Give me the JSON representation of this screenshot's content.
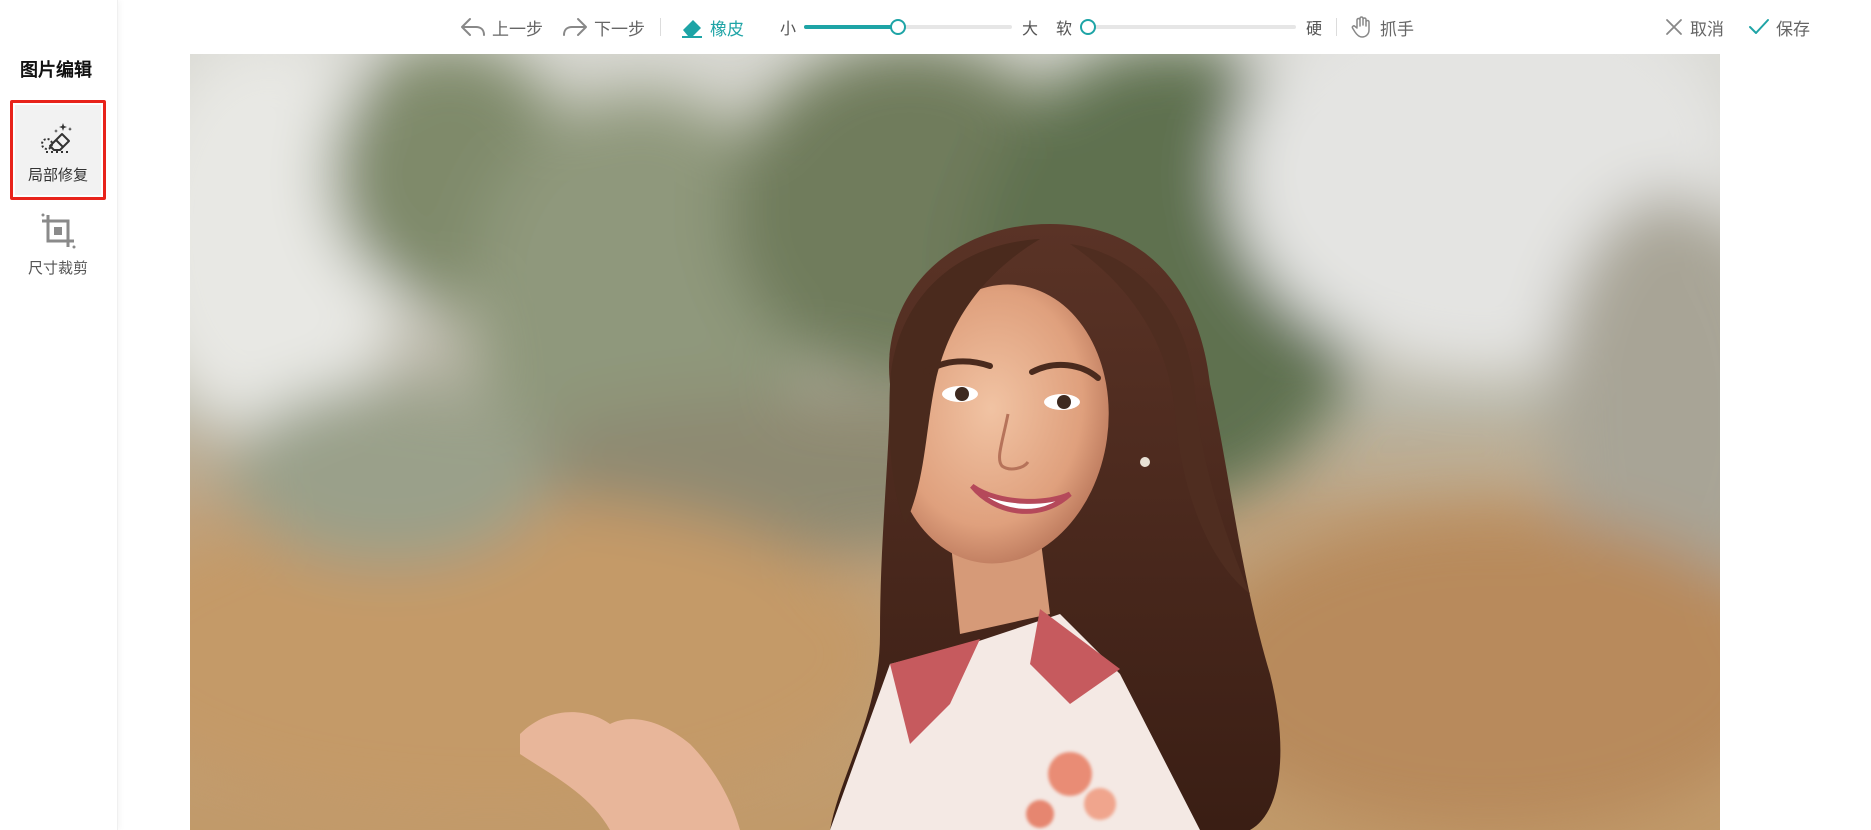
{
  "sidebar": {
    "title": "图片编辑",
    "tools": [
      {
        "label": "局部修复",
        "icon": "eraser-sparkle-icon",
        "active": true
      },
      {
        "label": "尺寸裁剪",
        "icon": "crop-icon",
        "active": false
      }
    ]
  },
  "toolbar": {
    "undo_label": "上一步",
    "redo_label": "下一步",
    "eraser_label": "橡皮",
    "size_min_label": "小",
    "size_max_label": "大",
    "size_value": 0.45,
    "hardness_min_label": "软",
    "hardness_max_label": "硬",
    "hardness_value": 0.0,
    "hand_label": "抓手",
    "cancel_label": "取消",
    "save_label": "保存"
  },
  "colors": {
    "accent": "#1ea4a6",
    "highlight_border": "#e8231b"
  }
}
